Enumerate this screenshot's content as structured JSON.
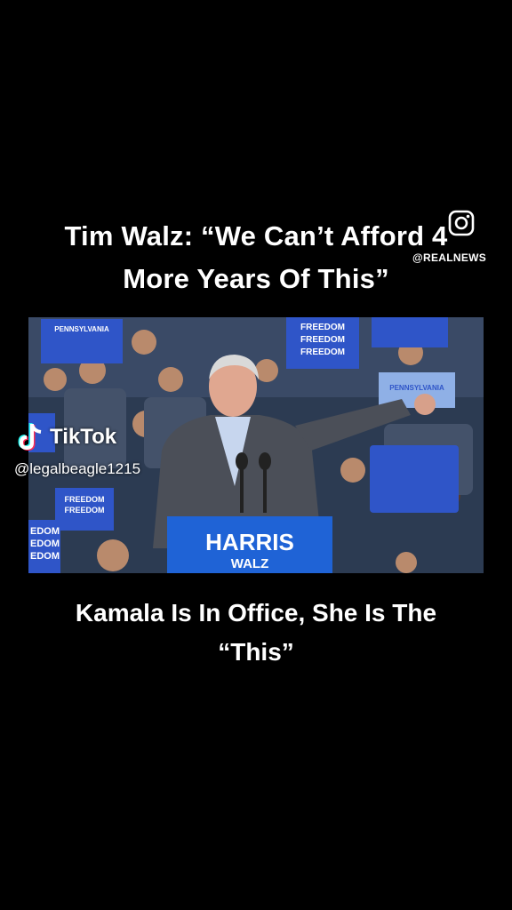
{
  "headline": {
    "line1": "Tim Walz: “We Can’t Afford 4",
    "line2": "More Years Of This”"
  },
  "source": {
    "handle": "@REALNEWS",
    "icon": "instagram-icon"
  },
  "video": {
    "signs": [
      "PENNSYLVANIA",
      "FREEDOM",
      "FREEDOM",
      "FREEDOM",
      "PENNSYLVANIA",
      "FREEDOM",
      "FREEDOM",
      "EDOM",
      "EDOM",
      "EDOM"
    ],
    "podium": {
      "line1": "HARRIS",
      "line2": "WALZ"
    }
  },
  "tiktok": {
    "logo_text": "TikTok",
    "username": "@legalbeagle1215",
    "icon": "tiktok-note-icon"
  },
  "caption": {
    "line1": "Kamala Is In Office, She Is The",
    "line2": "“This”"
  },
  "colors": {
    "background": "#000000",
    "sign_blue": "#2f55c8",
    "podium_blue": "#1f63d6",
    "text": "#ffffff"
  }
}
